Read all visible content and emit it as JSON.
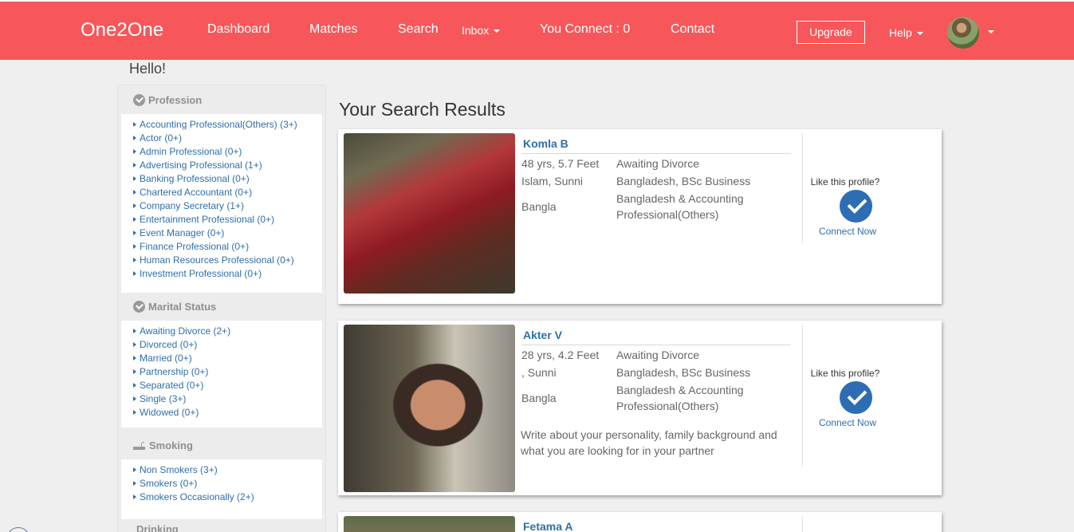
{
  "nav": {
    "brand": "One2One",
    "dashboard": "Dashboard",
    "matches": "Matches",
    "search": "Search",
    "inbox": "Inbox",
    "you_connect": "You Connect : 0",
    "contact": "Contact",
    "upgrade": "Upgrade",
    "help": "Help"
  },
  "greeting": "Hello!",
  "sidebar": {
    "profession": {
      "title": "Profession",
      "items": [
        "Accounting Professional(Others) (3+)",
        "Actor (0+)",
        "Admin Professional (0+)",
        "Advertising Professional (1+)",
        "Banking Professional (0+)",
        "Chartered Accountant (0+)",
        "Company Secretary (1+)",
        "Entertainment Professional (0+)",
        "Event Manager (0+)",
        "Finance Professional (0+)",
        "Human Resources Professional (0+)",
        "Investment Professional (0+)"
      ]
    },
    "marital": {
      "title": "Marital Status",
      "items": [
        "Awaiting Divorce (2+)",
        "Divorced (0+)",
        "Married (0+)",
        "Partnership (0+)",
        "Separated (0+)",
        "Single (3+)",
        "Widowed (0+)"
      ]
    },
    "smoking": {
      "title": "Smoking",
      "items": [
        "Non Smokers (3+)",
        "Smokers (0+)",
        "Smokers Occasionally (2+)"
      ]
    },
    "drinking": {
      "title": "Drinking"
    }
  },
  "results": {
    "title": "Your Search Results",
    "cards": [
      {
        "name": "Komla B",
        "age_height": "48 yrs, 5.7 Feet",
        "religion": "Islam, Sunni",
        "language": "Bangla",
        "marital": "Awaiting Divorce",
        "country_edu": "Bangladesh, BSc Business",
        "country_prof": "Bangladesh & Accounting Professional(Others)",
        "about": "",
        "like": "Like this profile?",
        "connect": "Connect Now"
      },
      {
        "name": "Akter V",
        "age_height": "28 yrs, 4.2 Feet",
        "religion": ", Sunni",
        "language": "Bangla",
        "marital": "Awaiting Divorce",
        "country_edu": "Bangladesh, BSc Business",
        "country_prof": "Bangladesh & Accounting Professional(Others)",
        "about": "Write about your personality, family background and what you are looking for in your partner",
        "like": "Like this profile?",
        "connect": "Connect Now"
      },
      {
        "name": "Fetama A"
      }
    ]
  }
}
